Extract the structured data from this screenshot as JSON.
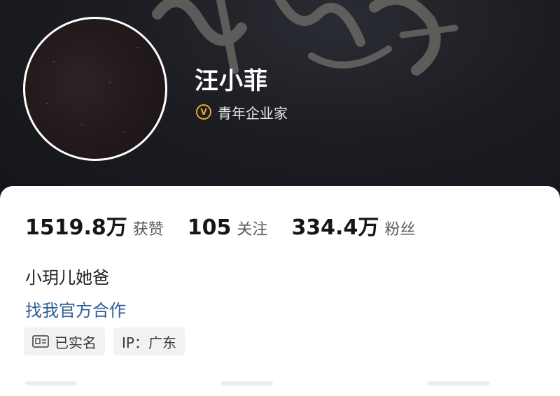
{
  "profile": {
    "name": "汪小菲",
    "verification": "青年企业家",
    "bio": "小玥儿她爸",
    "cooperation_link": "找我官方合作"
  },
  "stats": [
    {
      "value": "1519.8万",
      "label": "获赞"
    },
    {
      "value": "105",
      "label": "关注"
    },
    {
      "value": "334.4万",
      "label": "粉丝"
    }
  ],
  "tags": {
    "real_name": "已实名",
    "ip": "IP：广东"
  },
  "colors": {
    "header_background": "#1c1d22",
    "verify_badge": "#e8a92a",
    "link": "#2f5f95",
    "tag_background": "#f1f2f4"
  },
  "icons": [
    "verified-v-icon",
    "id-card-icon"
  ]
}
